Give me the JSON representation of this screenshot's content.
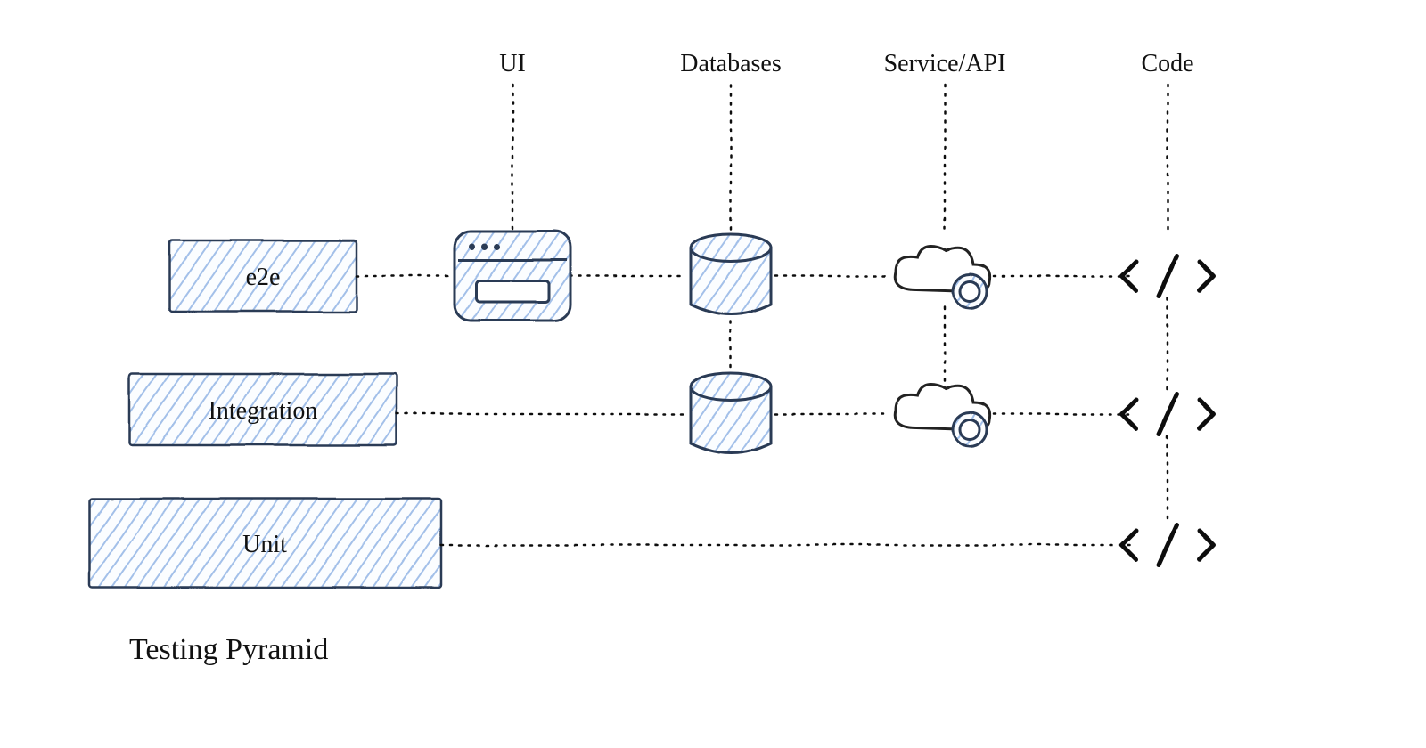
{
  "title": "Testing Pyramid",
  "columns": {
    "ui": "UI",
    "db": "Databases",
    "svc": "Service/API",
    "code": "Code"
  },
  "levels": {
    "e2e": "e2e",
    "integration": "Integration",
    "unit": "Unit"
  },
  "colors": {
    "fillBlue": "#5a8ed6",
    "lineDark": "#222"
  },
  "icons": {
    "browser": "browser-window-icon",
    "database": "database-cylinder-icon",
    "service": "cloud-gear-icon",
    "code": "code-angle-icon"
  },
  "layout_note": "Hand-drawn testing-pyramid diagram. Three stacked blue rectangles (widening downward) on the left labeled e2e / Integration / Unit. Dotted horizontal connectors to four columns on the right labeled UI, Databases, Service/API, Code. The e2e row connects to all four column icons; Integration connects to Databases, Service/API, Code; Unit connects only to Code."
}
